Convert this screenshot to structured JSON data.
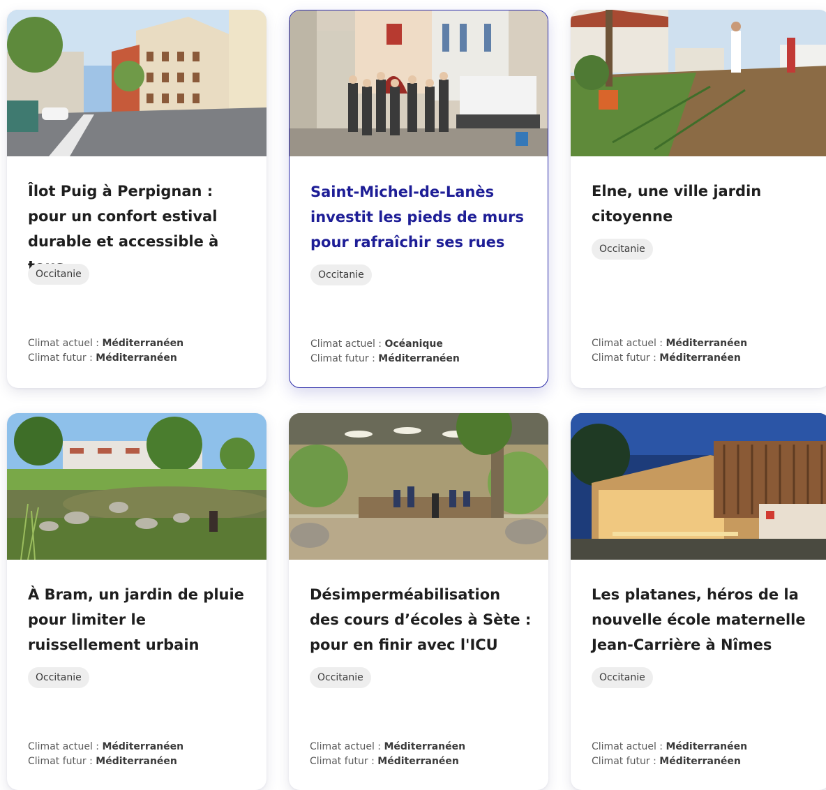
{
  "labels": {
    "climat_actuel": "Climat actuel :",
    "climat_futur": "Climat futur :"
  },
  "accent_color": "#1d1d96",
  "cards": [
    {
      "title": "Îlot Puig à Perpignan : pour un confort estival durable et accessible à tous",
      "region": "Occitanie",
      "climat_actuel": "Méditerranéen",
      "climat_futur": "Méditerranéen",
      "image": "street-buildings-photo"
    },
    {
      "title": "Saint-Michel-de-Lanès investit les pieds de murs pour rafraîchir ses rues",
      "region": "Occitanie",
      "climat_actuel": "Océanique",
      "climat_futur": "Méditerranéen",
      "image": "village-street-group-photo"
    },
    {
      "title": "Elne, une ville jardin citoyenne",
      "region": "Occitanie",
      "climat_actuel": "Méditerranéen",
      "climat_futur": "Méditerranéen",
      "image": "garden-planting-photo"
    },
    {
      "title": "À Bram, un jardin de pluie pour limiter le ruissellement urbain",
      "region": "Occitanie",
      "climat_actuel": "Méditerranéen",
      "climat_futur": "Méditerranéen",
      "image": "rain-garden-pond-photo"
    },
    {
      "title": "Désimperméabilisation des cours d’écoles à Sète : pour en finir avec l'ICU",
      "region": "Occitanie",
      "climat_actuel": "Méditerranéen",
      "climat_futur": "Méditerranéen",
      "image": "schoolyard-trees-photo"
    },
    {
      "title": "Les platanes, héros de la nouvelle école maternelle Jean-Carrière à Nîmes",
      "region": "Occitanie",
      "climat_actuel": "Méditerranéen",
      "climat_futur": "Méditerranéen",
      "image": "modern-school-night-photo"
    }
  ]
}
